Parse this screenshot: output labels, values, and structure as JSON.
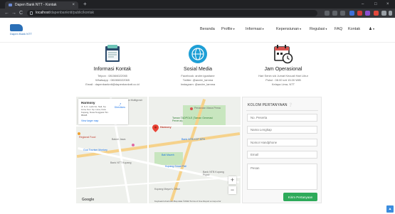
{
  "browser": {
    "tab_title": "Dapen Bank NTT - Kontak",
    "tab_close": "×",
    "new_tab": "+",
    "window_controls": [
      "–",
      "□",
      "×"
    ],
    "nav_icons": [
      "←",
      "→",
      "C"
    ],
    "url_host": "localhost",
    "url_path": "/dapenbankntt/public/kontak"
  },
  "site": {
    "logo_text": "Dapen Bank NTT",
    "nav": [
      {
        "label": "Beranda",
        "dropdown": false
      },
      {
        "label": "Profile",
        "dropdown": true
      },
      {
        "label": "Informasi",
        "dropdown": true
      },
      {
        "label": "Kepensiunan",
        "dropdown": true
      },
      {
        "label": "Regulasi",
        "dropdown": true
      },
      {
        "label": "FAQ",
        "dropdown": false
      },
      {
        "label": "Kontak",
        "dropdown": false
      }
    ],
    "caret": "▾",
    "user_caret": "▾"
  },
  "cards": {
    "contact": {
      "heading": "Informasi Kontak",
      "lines": [
        "Telpon : 081566022065",
        "Whatsapp : 081566022065",
        "Email : dapenbankntt@dapenbankntt.co.id"
      ]
    },
    "social": {
      "heading": "Sosial Media",
      "lines": [
        "Facebook: andre.lgustiane",
        "Twitter: @andre_lamma",
        "Instagram: @andre_lamma"
      ]
    },
    "hours": {
      "heading": "Jam Operasional",
      "lines": [
        "Hari Senin s/d Jumat Kecuali Hari Libur",
        "Pukul : 08.00 s/d 15.00 WIB",
        "Kelapa Lima, NTT"
      ]
    }
  },
  "map": {
    "infobox_title": "Harmony",
    "infobox_address": "Jl. S. K. Lerik No. Nail, Kp. Lima, Kec. Kp. Lima, Kota Kupang, Nusa Tenggara Tim. 85228",
    "infobox_directions": "Directions",
    "infobox_larger": "View larger map",
    "labels": [
      "Toko Multigrosir",
      "Penandan Mana Pema",
      "Taman TADPOLE (Taman Generasi Penerus)",
      "Regional Food",
      "Bakmi Jawa",
      "Harmony",
      "Gua Tourism Monkey",
      "Bank NTT Kupang",
      "Bali Mazeh",
      "Bank NTB KCP KPH",
      "Kupang Mayor's Office",
      "Kupang Smart Pall",
      "Bank NTB Kupang Puput"
    ],
    "zoom_in": "+",
    "zoom_out": "−",
    "google": "Google",
    "footer": "Keyboard shortcuts   Map data ©2022   Terms of Use   Report a map error"
  },
  "form": {
    "title": "KOLOM PERTANYAAN",
    "fields": [
      {
        "placeholder": "No. Peserta"
      },
      {
        "placeholder": "Nama Lengkap"
      },
      {
        "placeholder": "Nomor Handphone"
      },
      {
        "placeholder": "Email"
      }
    ],
    "message_placeholder": "Pesan",
    "submit_label": "Kirim Pertanyaan"
  },
  "scroll_top": "▲",
  "colors": {
    "primary": "#2a6fb7",
    "success": "#2eaa5a",
    "chrome_dark": "#202124"
  }
}
